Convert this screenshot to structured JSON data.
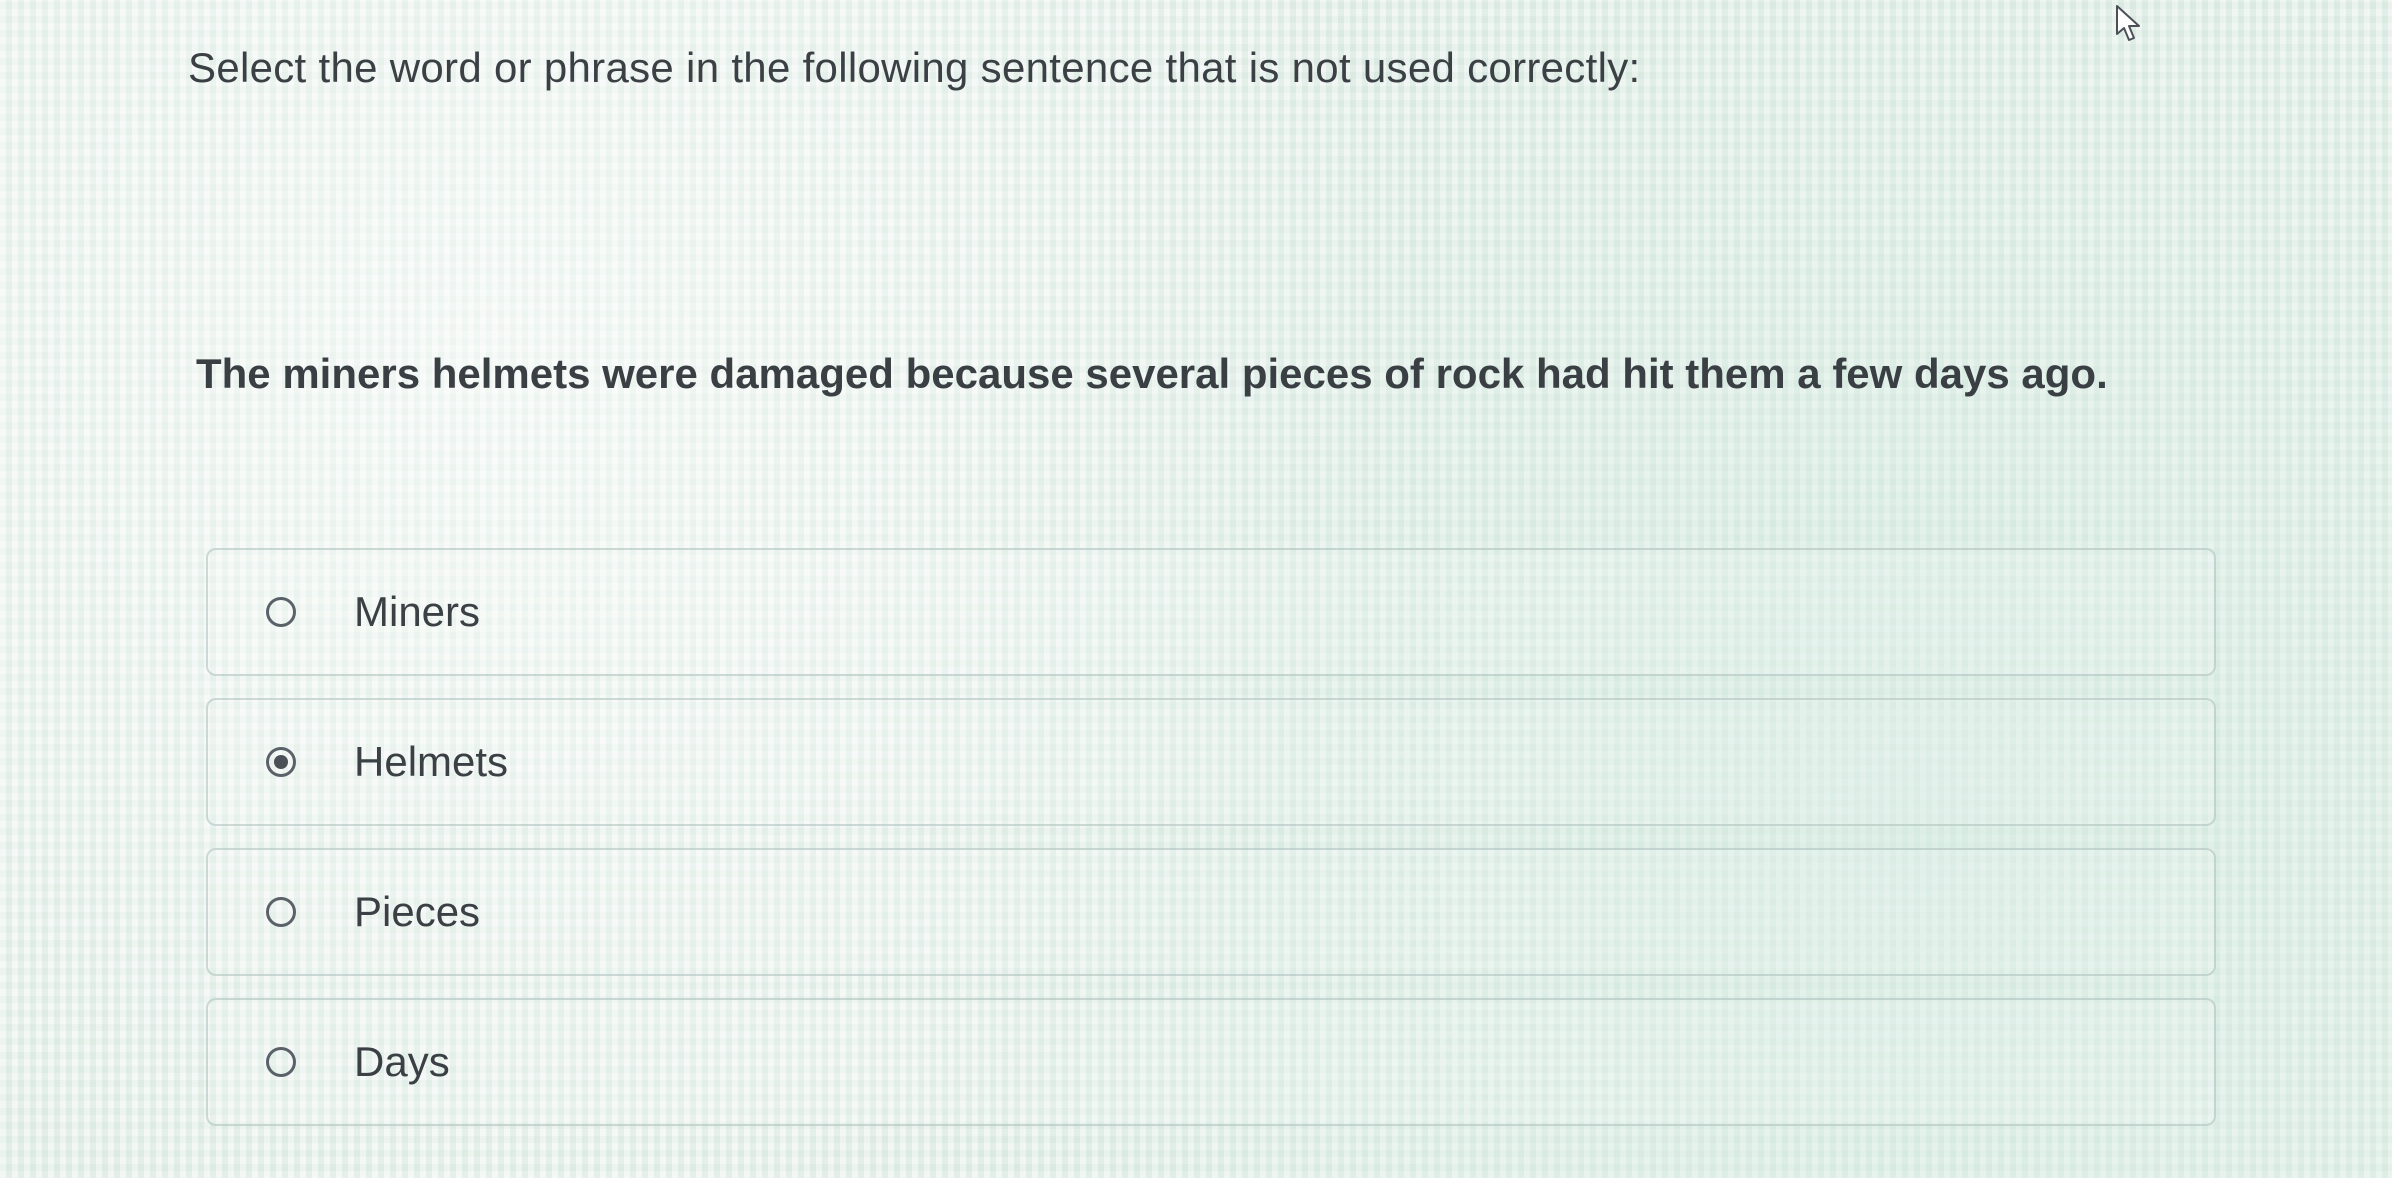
{
  "question": {
    "prompt": "Select the word or phrase in the following sentence that is not used correctly:",
    "sentence": "The miners helmets were damaged because several pieces of rock had hit them a few days ago."
  },
  "options": [
    {
      "label": "Miners",
      "selected": false
    },
    {
      "label": "Helmets",
      "selected": true
    },
    {
      "label": "Pieces",
      "selected": false
    },
    {
      "label": "Days",
      "selected": false
    }
  ]
}
